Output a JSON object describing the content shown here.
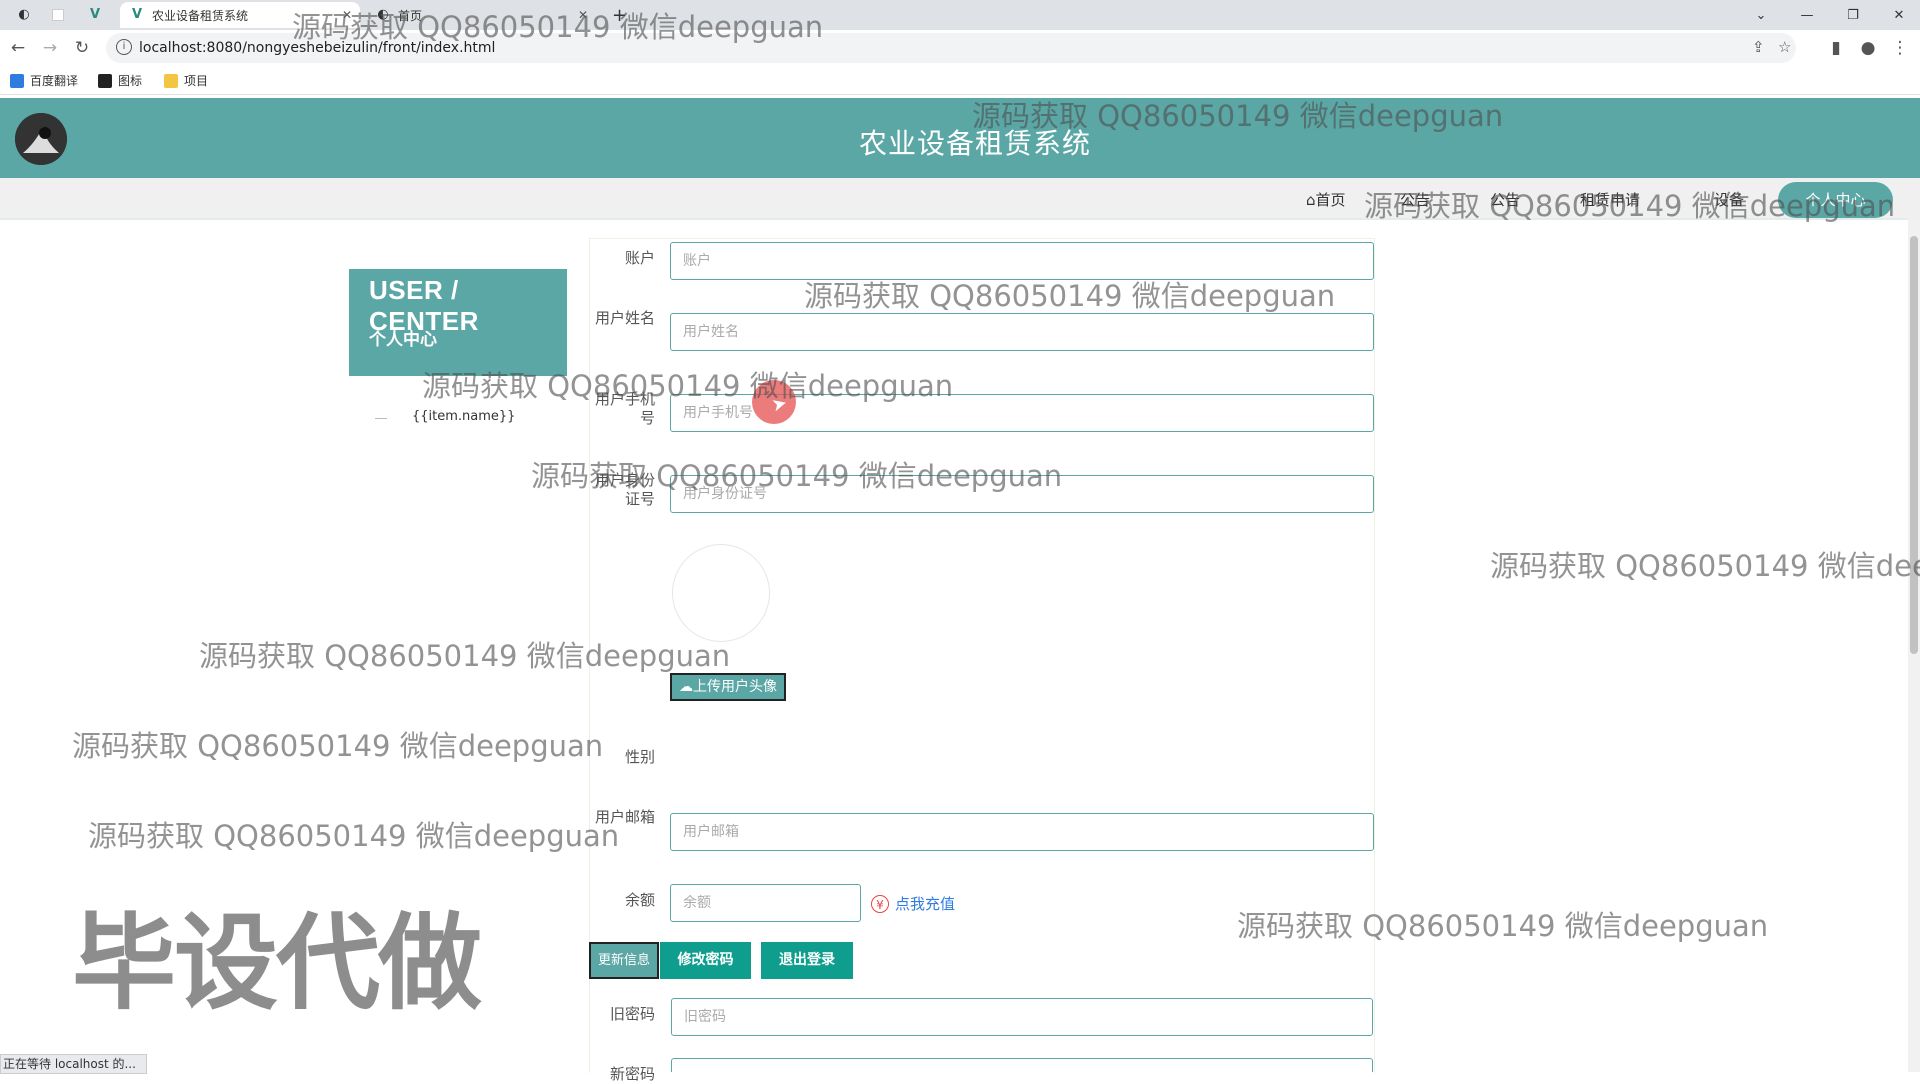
{
  "browser": {
    "tabs": [
      {
        "label": "农业设备租赁系统",
        "active": true
      },
      {
        "label": "首页",
        "active": false
      }
    ],
    "new_tab": "+",
    "url": "localhost:8080/nongyeshebeizulin/front/index.html",
    "bookmarks": [
      "百度翻译",
      "图标",
      "项目"
    ],
    "status_text": "正在等待 localhost 的..."
  },
  "site": {
    "title": "农业设备租赁系统",
    "nav": {
      "home": "首页",
      "item2": "公告",
      "item3": "公告",
      "item4": "租赁申请",
      "item5": "设备",
      "pill": "个人中心"
    }
  },
  "user_center": {
    "title": "USER / CENTER",
    "subtitle": "个人中心",
    "menu_item": "{{item.name}}"
  },
  "form": {
    "account": {
      "label": "账户",
      "placeholder": "账户"
    },
    "name": {
      "label": "用户姓名",
      "placeholder": "用户姓名"
    },
    "phone": {
      "label": "用户手机号",
      "placeholder": "用户手机号"
    },
    "id_card": {
      "label": "用户身份证号",
      "placeholder": "用户身份证号"
    },
    "upload_label": "上传用户头像",
    "gender": {
      "label": "性别"
    },
    "email": {
      "label": "用户邮箱",
      "placeholder": "用户邮箱"
    },
    "balance": {
      "label": "余额",
      "placeholder": "余额"
    },
    "recharge_label": "点我充值",
    "buttons": {
      "update": "更新信息",
      "change_password": "修改密码",
      "logout": "退出登录"
    },
    "old_password": {
      "label": "旧密码",
      "placeholder": "旧密码"
    },
    "new_password": {
      "label": "新密码"
    }
  },
  "watermarks": {
    "text": "源码获取 QQ86050149 微信deepguan",
    "stamp": "毕设代做"
  },
  "colors": {
    "brand": "#5ba7a5",
    "button": "#0f9e8e",
    "link": "#2f7be0"
  }
}
